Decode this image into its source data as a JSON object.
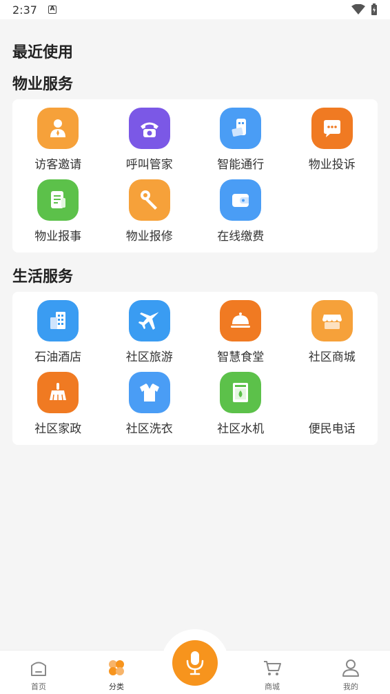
{
  "status_bar": {
    "time": "2:37",
    "notification_letter": "A"
  },
  "sections": {
    "recent": {
      "title": "最近使用"
    },
    "property": {
      "title": "物业服务",
      "items": [
        {
          "label": "访客邀请",
          "icon": "visitor-icon",
          "color": "#f6a13a"
        },
        {
          "label": "呼叫管家",
          "icon": "phone-icon",
          "color": "#7b58e6"
        },
        {
          "label": "智能通行",
          "icon": "access-card-icon",
          "color": "#4a9df5"
        },
        {
          "label": "物业投诉",
          "icon": "complaint-chat-icon",
          "color": "#f07a22"
        },
        {
          "label": "物业报事",
          "icon": "report-document-icon",
          "color": "#5cc14a"
        },
        {
          "label": "物业报修",
          "icon": "wrench-icon",
          "color": "#f6a13a"
        },
        {
          "label": "在线缴费",
          "icon": "wallet-icon",
          "color": "#4a9df5"
        }
      ]
    },
    "life": {
      "title": "生活服务",
      "items": [
        {
          "label": "石油酒店",
          "icon": "hotel-building-icon",
          "color": "#3a9cf2"
        },
        {
          "label": "社区旅游",
          "icon": "airplane-icon",
          "color": "#3a9cf2"
        },
        {
          "label": "智慧食堂",
          "icon": "food-cloche-icon",
          "color": "#f07a22"
        },
        {
          "label": "社区商城",
          "icon": "shop-awning-icon",
          "color": "#f6a13a"
        },
        {
          "label": "社区家政",
          "icon": "cleaning-brush-icon",
          "color": "#f07a22"
        },
        {
          "label": "社区洗衣",
          "icon": "shirt-icon",
          "color": "#4a9df5"
        },
        {
          "label": "社区水机",
          "icon": "water-machine-icon",
          "color": "#5cc14a"
        },
        {
          "label": "便民电话",
          "icon": "",
          "color": ""
        }
      ]
    }
  },
  "tab_bar": {
    "home": "首页",
    "category": "分类",
    "mall": "商城",
    "mine": "我的",
    "accent": "#f7941d"
  }
}
